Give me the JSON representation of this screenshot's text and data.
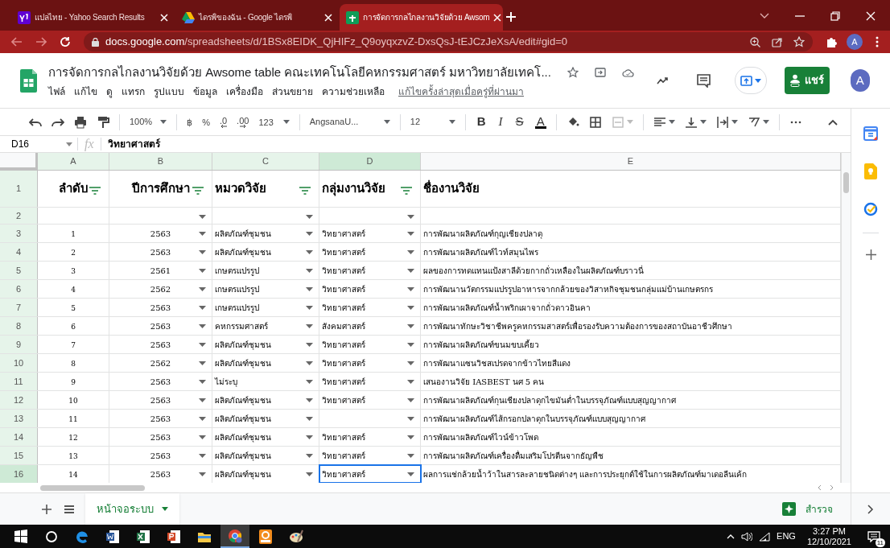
{
  "browser": {
    "tabs": [
      {
        "title": "แปลไทย - Yahoo Search Results",
        "selected": false
      },
      {
        "title": "ไดรฟ์ของฉัน - Google ไดรฟ์",
        "selected": false
      },
      {
        "title": "การจัดการกลไกลงานวิจัยด้วย Awsom",
        "selected": true
      }
    ],
    "url_host": "docs.google.com",
    "url_path": "/spreadsheets/d/1BSx8EIDK_QjHIFz_Q9oyqxzvZ-DxsQsJ-tEJCzJeXsA/edit#gid=0",
    "profile": "A"
  },
  "doc": {
    "title": "การจัดการกลไกลงานวิจัยด้วย Awsome table คณะเทคโนโลยีคหกรรมศาสตร์ มหาวิทยาลัยเทคโ...",
    "menu": [
      "ไฟล์",
      "แก้ไข",
      "ดู",
      "แทรก",
      "รูปแบบ",
      "ข้อมูล",
      "เครื่องมือ",
      "ส่วนขยาย",
      "ความช่วยเหลือ"
    ],
    "last_edit": "แก้ไขครั้งล่าสุดเมื่อครู่ที่ผ่านมา",
    "share": "แชร์",
    "avatar": "A"
  },
  "toolbar": {
    "zoom": "100%",
    "number_formats": [
      "฿",
      "%",
      ".0",
      ".00",
      "123"
    ],
    "font": "AngsanaU...",
    "font_size": "12",
    "styles": [
      {
        "kind": "bold",
        "label": "B"
      },
      {
        "kind": "italic",
        "label": "I"
      },
      {
        "kind": "strike",
        "label": "S"
      },
      {
        "kind": "color",
        "label": "A"
      }
    ]
  },
  "formula_bar": {
    "cell": "D16",
    "fx": "fx",
    "value": "วิทยาศาสตร์"
  },
  "sheet": {
    "columns": [
      {
        "letter": "A",
        "selected": false,
        "filter": true,
        "dropdown": false
      },
      {
        "letter": "B",
        "selected": false,
        "filter": true,
        "dropdown": true
      },
      {
        "letter": "C",
        "selected": false,
        "filter": true,
        "dropdown": true
      },
      {
        "letter": "D",
        "selected": true,
        "filter": true,
        "dropdown": true
      },
      {
        "letter": "E",
        "selected": false,
        "filter": false,
        "dropdown": false
      }
    ],
    "rows": [
      {
        "number": "1",
        "kind": "header",
        "selected": false,
        "cells": [
          "ลำดับ",
          "ปีการศึกษา",
          "หมวดวิจัย",
          "กลุ่มงานวิจัย",
          "ชื่องานวิจัย"
        ]
      },
      {
        "number": "2",
        "kind": "data",
        "selected": false,
        "cells": [
          null,
          null,
          null,
          null,
          null
        ]
      },
      {
        "number": "3",
        "kind": "data",
        "selected": false,
        "cells": [
          "1",
          "2563",
          "ผลิตภัณฑ์ชุมชน",
          "วิทยาศาสตร์",
          "การพัฒนาผลิตภัณฑ์กุญเชียงปลาดุ"
        ]
      },
      {
        "number": "4",
        "kind": "data",
        "selected": false,
        "cells": [
          "2",
          "2563",
          "ผลิตภัณฑ์ชุมชน",
          "วิทยาศาสตร์",
          "การพัฒนาผลิตภัณฑ์ไวท์สมุนไพร"
        ]
      },
      {
        "number": "5",
        "kind": "data",
        "selected": false,
        "cells": [
          "3",
          "2561",
          "เกษตรแปรรูป",
          "วิทยาศาสตร์",
          "ผลของการทดแทนแป้งสาลีด้วยกากถั่วเหลืองในผลิตภัณฑ์บราวนี่"
        ]
      },
      {
        "number": "6",
        "kind": "data",
        "selected": false,
        "cells": [
          "4",
          "2562",
          "เกษตรแปรรูป",
          "วิทยาศาสตร์",
          "การพัฒนานวัตกรรมแปรรูปอาหารจากกล้วยของวิสาหกิจชุมชนกลุ่มแม่บ้านเกษตรกร"
        ]
      },
      {
        "number": "7",
        "kind": "data",
        "selected": false,
        "cells": [
          "5",
          "2563",
          "เกษตรแปรรูป",
          "วิทยาศาสตร์",
          "การพัฒนาผลิตภัณฑ์น้ำพริกเผาจากถั่วดาวอินคา"
        ]
      },
      {
        "number": "8",
        "kind": "data",
        "selected": false,
        "cells": [
          "6",
          "2563",
          "คหกรรมศาสตร์",
          "สังคมศาสตร์",
          "การพัฒนาทักษะวิชาชีพครูคหกรรมสาสตร์เพื่อรองรับความต้องการของสถาบันอาชีวศึกษา"
        ]
      },
      {
        "number": "9",
        "kind": "data",
        "selected": false,
        "cells": [
          "7",
          "2563",
          "ผลิตภัณฑ์ชุมชน",
          "วิทยาศาสตร์",
          "การพัฒนาผลิตภัณฑ์ขนมขบเคี้ยว"
        ]
      },
      {
        "number": "10",
        "kind": "data",
        "selected": false,
        "cells": [
          "8",
          "2562",
          "ผลิตภัณฑ์ชุมชน",
          "วิทยาศาสตร์",
          "การพัฒนาแซนวิชสเปรดจากข้าวไทยสีแดง"
        ]
      },
      {
        "number": "11",
        "kind": "data",
        "selected": false,
        "cells": [
          "9",
          "2563",
          "ไม่ระบุ",
          "วิทยาศาสตร์",
          "เสนองานวิจัย IASBEST นศ 5 คน"
        ]
      },
      {
        "number": "12",
        "kind": "data",
        "selected": false,
        "cells": [
          "10",
          "2563",
          "ผลิตภัณฑ์ชุมชน",
          "วิทยาศาสตร์",
          "การพัฒนาผลิตภัณฑ์กุนเชียงปลาดุกไขมันต่ำในบรรจุภัณฑ์แบบสุญญากาศ"
        ]
      },
      {
        "number": "13",
        "kind": "data",
        "selected": false,
        "cells": [
          "11",
          "2563",
          "ผลิตภัณฑ์ชุมชน",
          null,
          "การพัฒนาผลิตภัณฑ์ไส้กรอกปลาดุกในบรรจุภัณฑ์แบบสุญญากาศ"
        ]
      },
      {
        "number": "14",
        "kind": "data",
        "selected": false,
        "cells": [
          "12",
          "2563",
          "ผลิตภัณฑ์ชุมชน",
          "วิทยาศาสตร์",
          "การพัฒนาผลิตภัณฑ์ไวน์ข้าวโพด"
        ]
      },
      {
        "number": "15",
        "kind": "data",
        "selected": false,
        "cells": [
          "13",
          "2563",
          "ผลิตภัณฑ์ชุมชน",
          "วิทยาศาสตร์",
          "การพัฒนาผลิตภัณฑ์เครื่องดื่มเสริมโปรตีนจากธัญพืช"
        ]
      },
      {
        "number": "16",
        "kind": "data",
        "selected": true,
        "cells": [
          "14",
          "2563",
          "ผลิตภัณฑ์ชุมชน",
          "วิทยาศาสตร์",
          "ผลการแช่กล้วยน้ำว้าในสารละลายชนิดต่างๆ และการประยุกต์ใช้ในการผลิตภัณฑ์มาเดอลีนเค้ก"
        ]
      }
    ]
  },
  "sheet_tabs": [
    {
      "label": "หน้าจอระบบ",
      "selected": true
    }
  ],
  "explore": "สำรวจ",
  "taskbar": {
    "language": "ENG",
    "time": "3:27 PM",
    "date": "12/10/2021",
    "notifications": "11"
  }
}
